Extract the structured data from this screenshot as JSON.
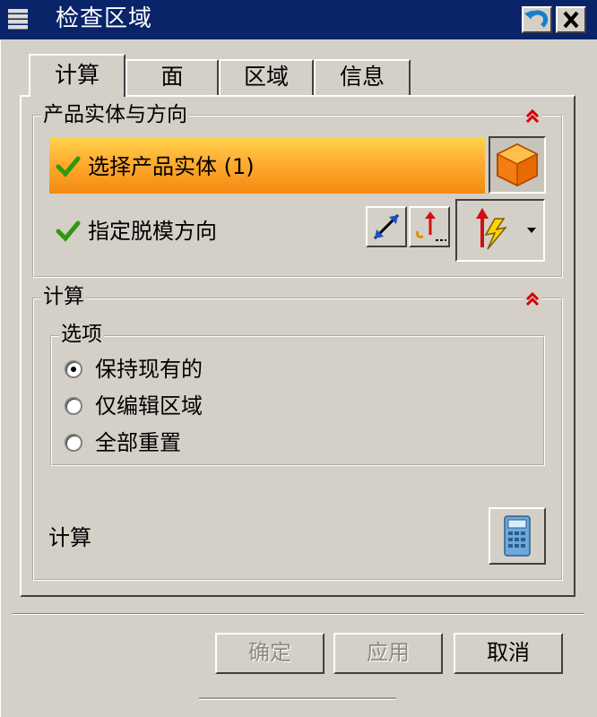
{
  "window": {
    "title": "检查区域"
  },
  "tabs": [
    {
      "label": "计算",
      "active": true
    },
    {
      "label": "面",
      "active": false
    },
    {
      "label": "区域",
      "active": false
    },
    {
      "label": "信息",
      "active": false
    }
  ],
  "product_group": {
    "title": "产品实体与方向",
    "select_label": "选择产品实体 (1)",
    "draft_label": "指定脱模方向"
  },
  "calc_group": {
    "title": "计算",
    "options": {
      "title": "选项",
      "items": [
        {
          "label": "保持现有的",
          "selected": true
        },
        {
          "label": "仅编辑区域",
          "selected": false
        },
        {
          "label": "全部重置",
          "selected": false
        }
      ]
    },
    "compute_label": "计算"
  },
  "buttons": {
    "ok": "确定",
    "apply": "应用",
    "cancel": "取消"
  },
  "colors": {
    "titlebar": "#0a246a",
    "highlight": "#ffab30",
    "check": "#2e9a0e",
    "collapse": "#d40000"
  }
}
